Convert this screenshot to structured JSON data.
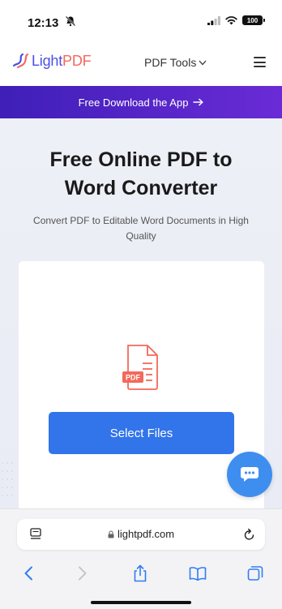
{
  "status_bar": {
    "time": "12:13",
    "battery": "100"
  },
  "header": {
    "logo_light": "Light",
    "logo_pdf": "PDF",
    "tools_menu_label": "PDF Tools"
  },
  "promo": {
    "label": "Free Download the App"
  },
  "main": {
    "title_line1": "Free Online PDF to",
    "title_line2": "Word Converter",
    "subtitle": "Convert PDF to Editable Word Documents in High Quality",
    "pdf_badge": "PDF",
    "select_files_label": "Select Files"
  },
  "browser": {
    "url": "lightpdf.com"
  },
  "colors": {
    "brand_blue": "#4a50e6",
    "brand_red": "#f26a5b",
    "banner_purple": "#4b22c4",
    "button_blue": "#3274ea",
    "chat_blue": "#3e8ef0",
    "safari_blue": "#2f7cf6"
  },
  "icons": [
    "bell-slash-icon",
    "signal-icon",
    "wifi-icon",
    "battery-icon",
    "logo-icon",
    "chevron-down-icon",
    "hamburger-icon",
    "arrow-right-icon",
    "pdf-file-icon",
    "chat-icon",
    "reader-icon",
    "lock-icon",
    "reload-icon",
    "back-icon",
    "forward-icon",
    "share-icon",
    "bookmarks-icon",
    "tabs-icon"
  ]
}
